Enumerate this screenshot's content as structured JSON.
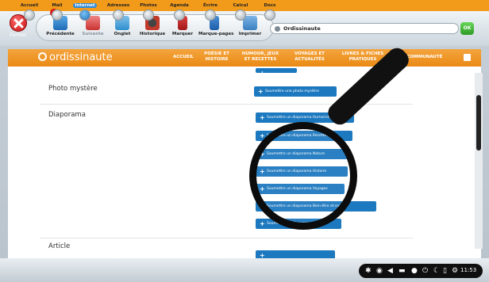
{
  "toolbar": {
    "close_label": "Fermer",
    "items": [
      {
        "label": "Précédente",
        "icon": "back-arrow-icon",
        "enabled": true
      },
      {
        "label": "Suivante",
        "icon": "forward-arrow-icon",
        "enabled": false
      },
      {
        "label": "Ongl​et",
        "icon": "tab-icon",
        "enabled": true
      },
      {
        "label": "Historique",
        "icon": "history-icon",
        "enabled": true
      },
      {
        "label": "Marquer",
        "icon": "bookmark-icon",
        "enabled": true
      },
      {
        "label": "Marque-pages",
        "icon": "bookmarks-icon",
        "enabled": true
      },
      {
        "label": "Imprimer",
        "icon": "printer-icon",
        "enabled": true
      }
    ],
    "address_value": "Ordissinaute",
    "ok_label": "OK"
  },
  "site_nav": {
    "logo": "ordissinaute",
    "items": [
      {
        "label": "ACCUEIL"
      },
      {
        "label": "POÉSIE ET HISTOIRE"
      },
      {
        "label": "HUMOUR, JEUX ET RECETTES"
      },
      {
        "label": "VOYAGES ET ACTUALITÉS"
      },
      {
        "label": "LIVRES & FICHES PRATIQUES"
      },
      {
        "label": "COMMUNAUTÉ"
      }
    ]
  },
  "main": {
    "sections": {
      "photo_mystere": "Photo mystère",
      "diaporama": "Diaporama",
      "article": "Article"
    },
    "photo_button": "Soumettre une photo mystère",
    "diaporama_buttons": [
      "Soumettre un diaporama Humoristique",
      "Soumettre un diaporama Recettes",
      "Soumettre un diaporama Nature",
      "Soumettre un diaporama Histoire",
      "Soumettre un diaporama Voyages",
      "Soumettre un diaporama Bien-être et santé",
      "Soumettre un diaporama Art"
    ]
  },
  "dock": {
    "items": [
      {
        "label": "Accueil"
      },
      {
        "label": "Mail",
        "badge": true
      },
      {
        "label": "Internet",
        "active": true
      },
      {
        "label": "Adresses"
      },
      {
        "label": "Photos"
      },
      {
        "label": "Agenda"
      },
      {
        "label": "Écrire"
      },
      {
        "label": "Calcul"
      },
      {
        "label": "Docs"
      }
    ],
    "time": "11:53"
  }
}
